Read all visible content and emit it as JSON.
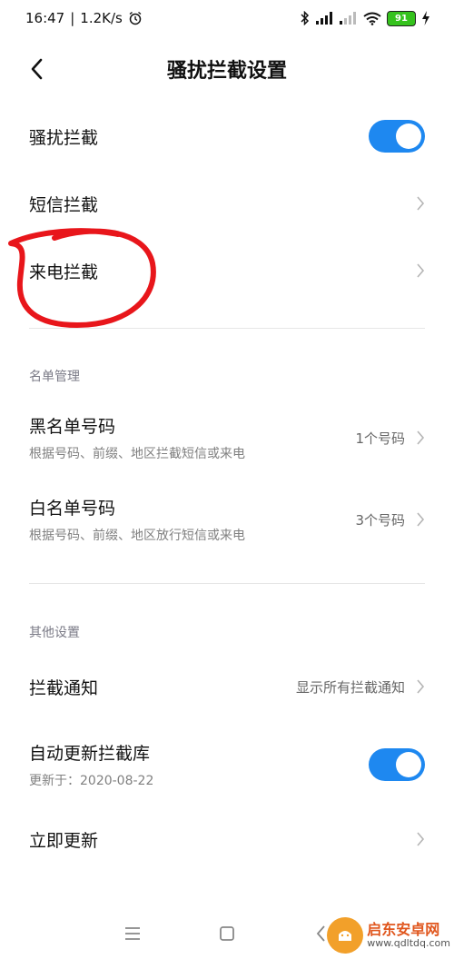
{
  "status": {
    "time": "16:47",
    "speed": "1.2K/s",
    "battery": "91"
  },
  "header": {
    "title": "骚扰拦截设置"
  },
  "main": {
    "harassment_block": {
      "label": "骚扰拦截",
      "enabled": true
    },
    "sms_block": {
      "label": "短信拦截"
    },
    "call_block": {
      "label": "来电拦截"
    },
    "list_section": {
      "label": "名单管理",
      "blacklist": {
        "title": "黑名单号码",
        "subtitle": "根据号码、前缀、地区拦截短信或来电",
        "value": "1个号码"
      },
      "whitelist": {
        "title": "白名单号码",
        "subtitle": "根据号码、前缀、地区放行短信或来电",
        "value": "3个号码"
      }
    },
    "other_section": {
      "label": "其他设置",
      "notification": {
        "title": "拦截通知",
        "value": "显示所有拦截通知"
      },
      "auto_update": {
        "title": "自动更新拦截库",
        "subtitle": "更新于：2020-08-22",
        "enabled": true
      },
      "update_now": {
        "title": "立即更新"
      }
    }
  },
  "annotation": {
    "color": "#e8161b"
  },
  "watermark": {
    "name": "启东安卓网",
    "url": "www.qdltdq.com"
  }
}
